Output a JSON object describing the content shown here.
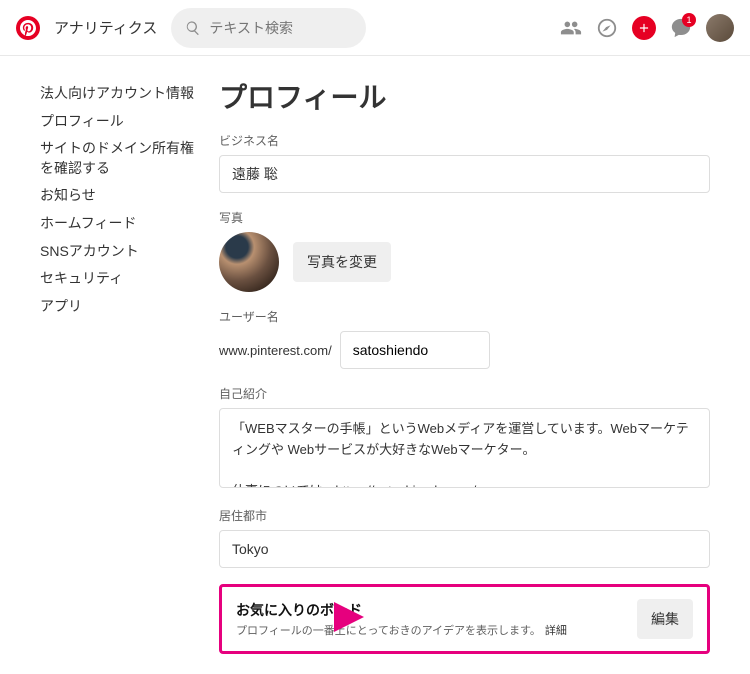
{
  "header": {
    "analytics_label": "アナリティクス",
    "search_placeholder": "テキスト検索",
    "notification_count": "1"
  },
  "sidebar": {
    "items": [
      {
        "label": "法人向けアカウント情報"
      },
      {
        "label": "プロフィール"
      },
      {
        "label": "サイトのドメイン所有権を確認する"
      },
      {
        "label": "お知らせ"
      },
      {
        "label": "ホームフィード"
      },
      {
        "label": "SNSアカウント"
      },
      {
        "label": "セキュリティ"
      },
      {
        "label": "アプリ"
      }
    ]
  },
  "page": {
    "title": "プロフィール",
    "business_name_label": "ビジネス名",
    "business_name_value": "遠藤 聡",
    "photo_label": "写真",
    "change_photo_btn": "写真を変更",
    "username_label": "ユーザー名",
    "url_prefix": "www.pinterest.com/",
    "username_value": "satoshiendo",
    "about_label": "自己紹介",
    "about_value": "「WEBマスターの手帳」というWebメディアを運営しています。Webマーケティングや Webサービスが大好きなWebマーケター。\n\n仕事については、https://satoshiendo.com/",
    "city_label": "居住都市",
    "city_value": "Tokyo"
  },
  "featured": {
    "title": "お気に入りのボード",
    "desc": "プロフィールの一番上にとっておきのアイデアを表示します。",
    "more": "詳細",
    "edit_btn": "編集"
  },
  "colors": {
    "accent": "#e60023",
    "highlight": "#e6007e"
  }
}
